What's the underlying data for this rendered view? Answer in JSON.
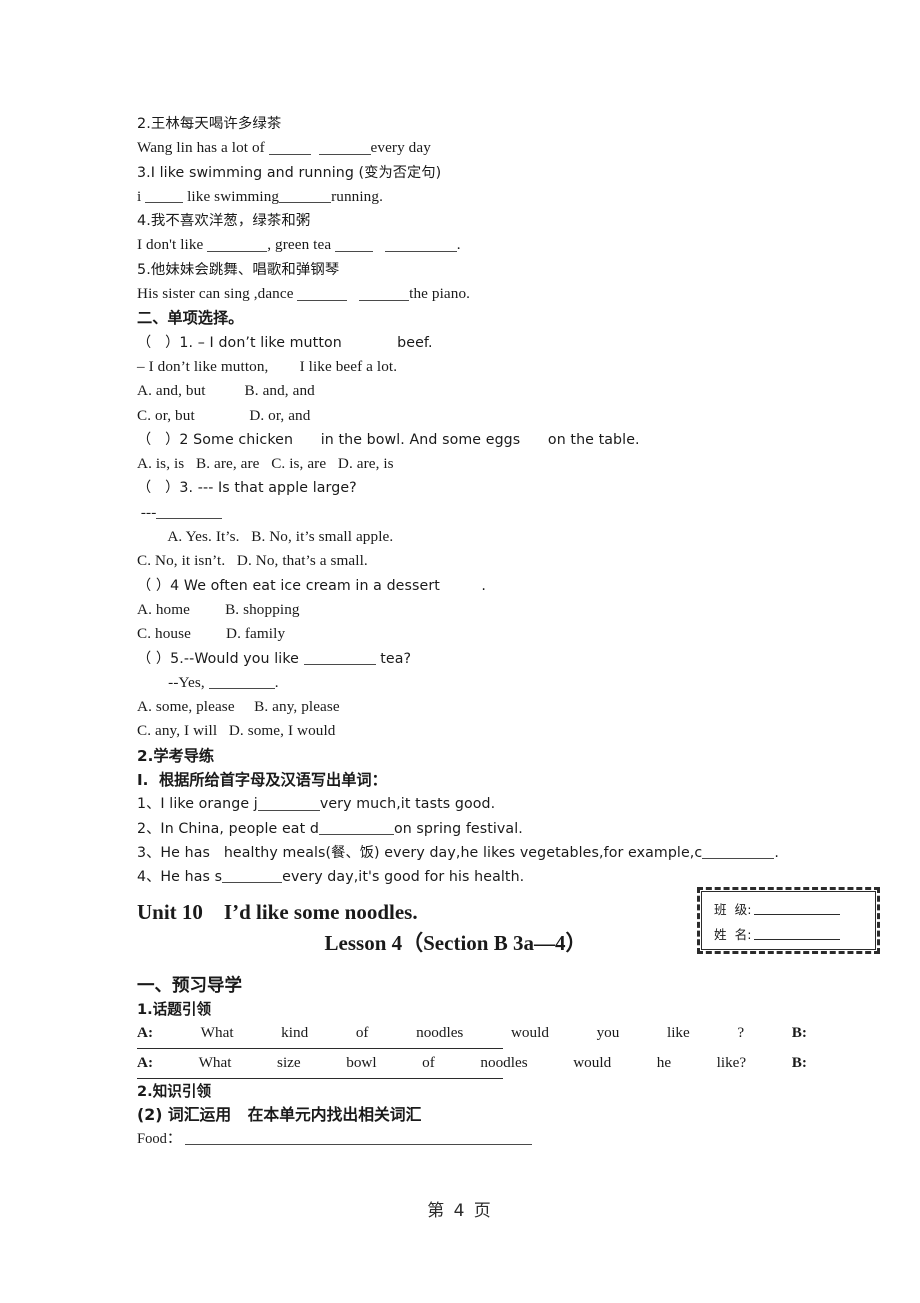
{
  "document": {
    "page_footer": "第 4 页"
  },
  "section_one": {
    "lines": [
      {
        "id": "q2_cn",
        "text": "2.王林每天喝许多绿茶",
        "style": "cn"
      },
      {
        "id": "q2_en_a",
        "text": "Wang lin has a lot of ",
        "blank1": 42,
        "mid": "  ",
        "blank2": 52,
        "tail": "every day"
      },
      {
        "id": "q3_cn",
        "text": "3.I like swimming and running (变为否定句)",
        "style": "mix"
      },
      {
        "id": "q3_en",
        "pre": "i ",
        "blank1": 38,
        "mid": " like swimming",
        "blank2": 52,
        "tail": "running."
      },
      {
        "id": "q4_cn",
        "text": "4.我不喜欢洋葱，绿茶和粥",
        "style": "cn"
      },
      {
        "id": "q4_en",
        "pre": "I don't like ",
        "blank1": 60,
        "mid": ", green tea ",
        "blank2": 38,
        "mid2": "   ",
        "blank3": 72,
        "tail": "."
      },
      {
        "id": "q5_cn",
        "text": "5.他妹妹会跳舞、唱歌和弹钢琴",
        "style": "cn"
      },
      {
        "id": "q5_en",
        "pre": "His sister can sing ,dance ",
        "blank1": 50,
        "mid": "   ",
        "blank2": 50,
        "tail": "the piano."
      }
    ]
  },
  "section_two": {
    "heading": "二、单项选择。",
    "items": [
      {
        "id": "mc1_q1",
        "text": "（   ）1. – I don’t like mutton            beef."
      },
      {
        "id": "mc1_q2",
        "text": "– I don’t like mutton,        I like beef a lot."
      },
      {
        "id": "mc1_ab",
        "text": "A. and, but          B. and, and"
      },
      {
        "id": "mc1_cd",
        "text": "C. or, but              D. or, and"
      },
      {
        "id": "mc2_q",
        "text": "（   ）2 Some chicken      in the bowl. And some eggs      on the table."
      },
      {
        "id": "mc2_opt",
        "text": "A. is, is   B. are, are   C. is, are   D. are, is"
      },
      {
        "id": "mc3_q",
        "text": "（   ）3. --- Is that apple large?"
      },
      {
        "id": "mc3_dash",
        "pre": " ---",
        "blank1": 66,
        "tail": ""
      },
      {
        "id": "mc3_ab",
        "text": "        A. Yes. It’s.   B. No, it’s small apple."
      },
      {
        "id": "mc3_cd",
        "text": "C. No, it isn’t.   D. No, that’s a small."
      },
      {
        "id": "mc4_q",
        "text": "（ ）4 We often eat ice cream in a dessert         ."
      },
      {
        "id": "mc4_ab",
        "text": "A. home         B. shopping"
      },
      {
        "id": "mc4_cd",
        "text": "C. house         D. family"
      },
      {
        "id": "mc5_q",
        "pre": "（ ）5.--Would you like ",
        "blank1": 72,
        "tail": " tea?"
      },
      {
        "id": "mc5_q2",
        "pre": "        --Yes, ",
        "blank1": 66,
        "tail": "."
      },
      {
        "id": "mc5_ab",
        "text": "A. some, please     B. any, please"
      },
      {
        "id": "mc5_cd",
        "text": "C. any, I will   D. some, I would"
      }
    ]
  },
  "section_exam": {
    "heading": "2.学考导练",
    "subheading": "I.  根据所给首字母及汉语写出单词：",
    "items": [
      {
        "id": "w1",
        "pre": "1、I like orange j",
        "blank1": 62,
        "tail": "very much,it tasts good."
      },
      {
        "id": "w2",
        "pre": "2、In China, people eat d",
        "blank1": 75,
        "tail": "on spring festival."
      },
      {
        "id": "w3",
        "pre": "3、He has   healthy meals(餐、饭) every day,he likes vegetables,for example,c",
        "blank1": 72,
        "tail": "."
      },
      {
        "id": "w4",
        "pre": "4、He has s",
        "blank1": 60,
        "tail": "every day,it's good for his health."
      }
    ]
  },
  "unit_header": {
    "unit_title": "Unit 10    I’d like some noodles.",
    "lesson_title": "Lesson 4（Section B 3a—4）"
  },
  "name_box": {
    "class_label": "班  级:",
    "name_label": "姓  名:"
  },
  "preview": {
    "heading": "一、预习导学",
    "sub1": "1.话题引领",
    "dialogue_1": {
      "label_a": "A:",
      "words": [
        "What",
        "kind",
        "of",
        "noodles",
        "would",
        "you",
        "like",
        "?"
      ],
      "label_b": "B:"
    },
    "dialogue_2": {
      "label_a": "A:",
      "words": [
        "What",
        "size",
        "bowl",
        "of",
        "noodles",
        "would",
        "he",
        "like?"
      ],
      "label_b": "B:"
    },
    "sub2": "2.知识引领",
    "sub3": "(2) 词汇运用   在本单元内找出相关词汇",
    "food_label": "Food："
  }
}
